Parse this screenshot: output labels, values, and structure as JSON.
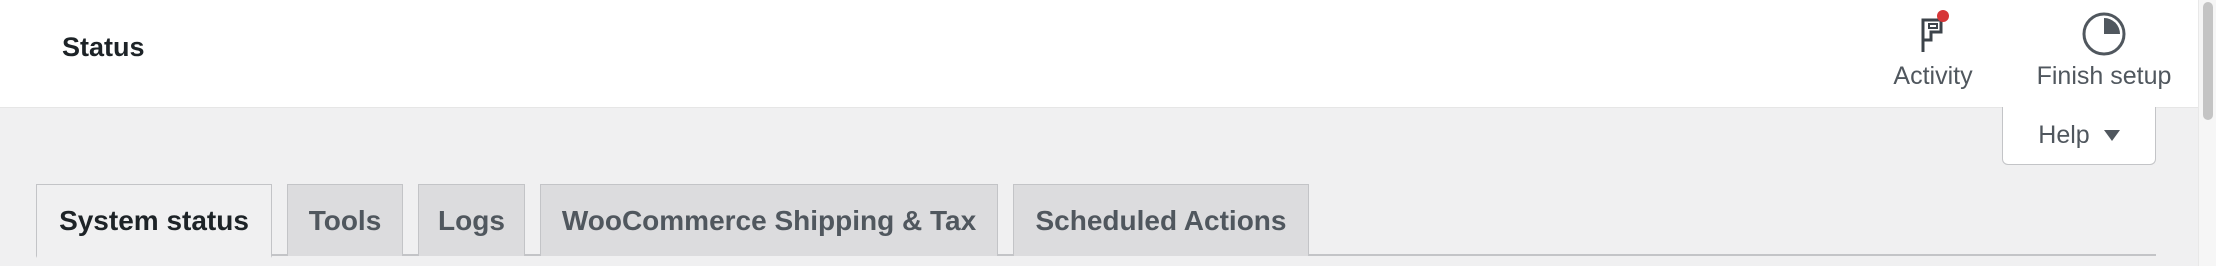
{
  "header": {
    "title": "Status",
    "actions": [
      {
        "label": "Activity",
        "icon": "flag-icon",
        "has_notification": true
      },
      {
        "label": "Finish setup",
        "icon": "progress-pie-icon"
      }
    ]
  },
  "help": {
    "label": "Help",
    "icon": "caret-down-icon"
  },
  "tabs": [
    {
      "label": "System status",
      "active": true
    },
    {
      "label": "Tools"
    },
    {
      "label": "Logs"
    },
    {
      "label": "WooCommerce Shipping & Tax"
    },
    {
      "label": "Scheduled Actions"
    }
  ],
  "colors": {
    "notification_dot": "#d63638",
    "header_bg": "#ffffff",
    "page_bg": "#f0f0f1"
  }
}
